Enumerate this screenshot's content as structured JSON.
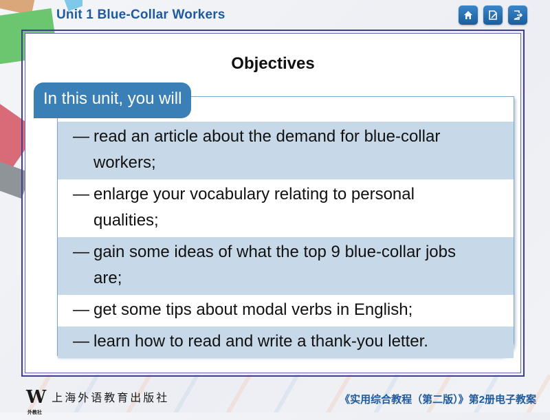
{
  "header": {
    "unit_title": "Unit 1 Blue-Collar Workers",
    "nav_buttons": [
      {
        "name": "home",
        "icon": "home-icon"
      },
      {
        "name": "notes",
        "icon": "edit-document-icon"
      },
      {
        "name": "exit",
        "icon": "exit-icon"
      }
    ]
  },
  "slide": {
    "title": "Objectives",
    "tab_label": "In this unit, you will",
    "items": [
      {
        "dash": "—",
        "line1": "read an article about the demand for blue-collar",
        "line2": "workers;",
        "shaded": true
      },
      {
        "dash": "—",
        "line1": "enlarge your vocabulary relating to personal",
        "line2": "qualities;",
        "shaded": false
      },
      {
        "dash": "—",
        "line1": "gain some ideas of what the top 9 blue-collar jobs",
        "line2": "are;",
        "shaded": true
      },
      {
        "dash": "—",
        "line1": "get some tips about modal verbs in English;",
        "line2": "",
        "shaded": false
      },
      {
        "dash": "—",
        "line1": "learn how to read and write a thank-you letter.",
        "line2": "",
        "shaded": true
      }
    ]
  },
  "footer": {
    "logo_letter": "W",
    "logo_caption": "外教社",
    "publisher": "上海外语教育出版社",
    "course": "《实用综合教程（第二版）》第2册电子教案"
  },
  "colors": {
    "accent": "#1f5a9e",
    "tab": "#3a80b6",
    "row_shade": "#c7d9e8",
    "frame": "#3f3d8e"
  }
}
